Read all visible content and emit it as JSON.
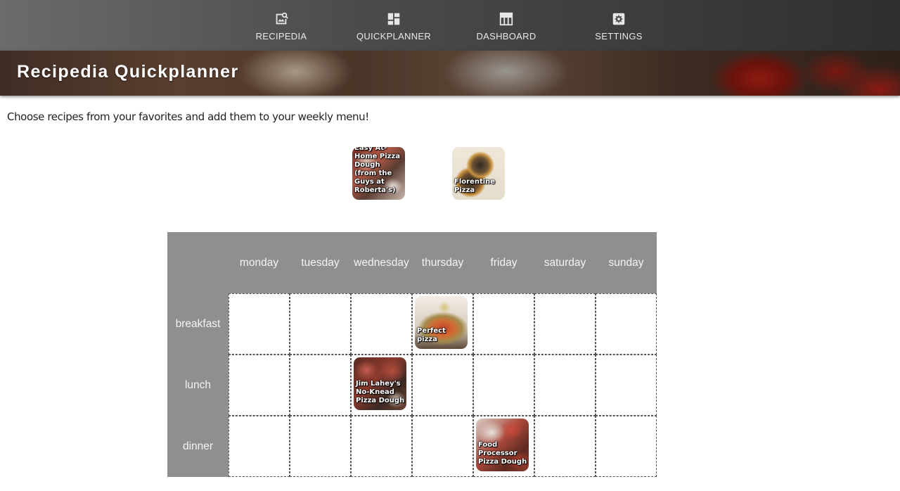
{
  "nav": {
    "items": [
      {
        "label": "RECIPEDIA",
        "icon": "image-search-icon"
      },
      {
        "label": "QUICKPLANNER",
        "icon": "dashboard-grid-icon"
      },
      {
        "label": "DASHBOARD",
        "icon": "table-layout-icon"
      },
      {
        "label": "SETTINGS",
        "icon": "gear-icon"
      }
    ]
  },
  "banner": {
    "title": "Recipedia Quickplanner"
  },
  "intro_text": "Choose recipes from your favorites and add them to your weekly menu!",
  "favorites": [
    {
      "name": "Easy At-Home Pizza Dough (from the Guys at Roberta's)"
    },
    {
      "name": "Florentine Pizza"
    }
  ],
  "planner": {
    "days": [
      "monday",
      "tuesday",
      "wednesday",
      "thursday",
      "friday",
      "saturday",
      "sunday"
    ],
    "meals": [
      "breakfast",
      "lunch",
      "dinner"
    ],
    "entries": [
      {
        "meal": "breakfast",
        "day": "thursday",
        "recipe": "Perfect pizza"
      },
      {
        "meal": "lunch",
        "day": "wednesday",
        "recipe": "Jim Lahey's No-Knead Pizza Dough"
      },
      {
        "meal": "dinner",
        "day": "friday",
        "recipe": "Food Processor Pizza Dough"
      }
    ]
  },
  "colors": {
    "nav_bg_start": "#6a6b6b",
    "nav_bg_end": "#2e2f31",
    "planner_header_bg": "#8f8f8f",
    "slot_border": "#555555"
  }
}
